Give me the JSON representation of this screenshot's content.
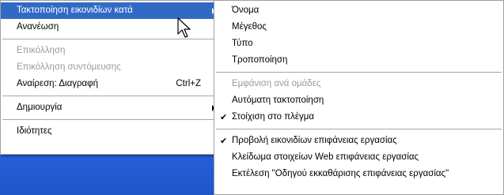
{
  "context_menu": {
    "items": [
      {
        "label": "Τακτοποίηση εικονιδίων κατά",
        "has_submenu": true,
        "highlighted": true
      },
      {
        "label": "Ανανέωση"
      },
      {
        "label": "Επικόλληση",
        "disabled": true
      },
      {
        "label": "Επικόλληση συντόμευσης",
        "disabled": true
      },
      {
        "label": "Αναίρεση: Διαγραφή",
        "shortcut": "Ctrl+Z"
      },
      {
        "label": "Δημιουργία",
        "has_submenu": true
      },
      {
        "label": "Ιδιότητες"
      }
    ]
  },
  "submenu": {
    "items": [
      {
        "label": "Όνομα"
      },
      {
        "label": "Μέγεθος"
      },
      {
        "label": "Τύπο"
      },
      {
        "label": "Τροποποίηση"
      },
      {
        "label": "Εμφάνιση ανά ομάδες",
        "disabled": true
      },
      {
        "label": "Αυτόματη τακτοποίηση"
      },
      {
        "label": "Στοίχιση στο πλέγμα",
        "checked": true
      },
      {
        "label": "Προβολή εικονιδίων επιφάνειας εργασίας",
        "checked": true
      },
      {
        "label": "Κλείδωμα στοιχείων Web επιφάνειας εργασίας"
      },
      {
        "label": "Εκτέλεση \"Οδηγού εκκαθάρισης επιφάνειας εργασίας\""
      }
    ]
  },
  "colors": {
    "highlight": "#316ac5",
    "disabled_text": "#9a9a9a",
    "desktop_blue": "#245edb"
  },
  "icons": {
    "check": "✔",
    "cursor": "arrow-cursor-icon",
    "submenu_arrow": "submenu-arrow-icon"
  }
}
